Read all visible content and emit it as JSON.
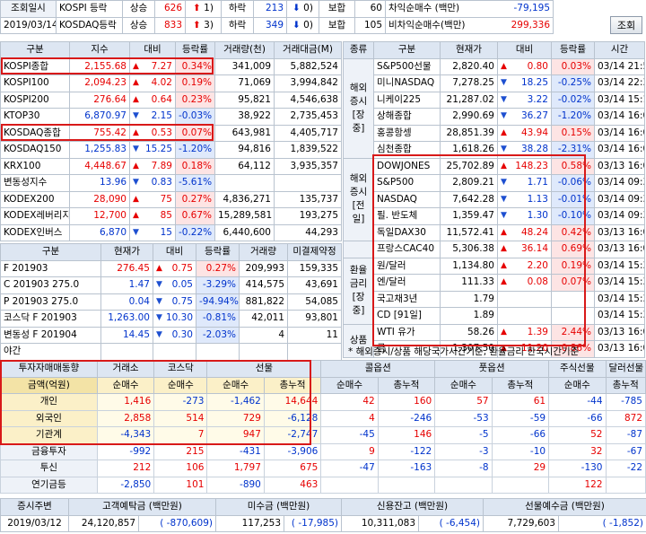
{
  "top": {
    "label1": "조회일시",
    "date": "2019/03/14",
    "rows": [
      {
        "market": "KOSPI 등락",
        "up_label": "상승",
        "up": "626",
        "limit_up": "1",
        "down_label": "하락",
        "down": "213",
        "limit_down": "0",
        "flat_label": "보합",
        "flat": "60"
      },
      {
        "market": "KOSDAQ등락",
        "up_label": "상승",
        "up": "833",
        "limit_up": "3",
        "down_label": "하락",
        "down": "349",
        "limit_down": "0",
        "flat_label": "보합",
        "flat": "105"
      }
    ],
    "arb": [
      {
        "label": "차익순매수 (백만)",
        "value": "-79,195"
      },
      {
        "label": "비차익순매수(백만)",
        "value": "299,336"
      }
    ],
    "query_button": "조회"
  },
  "index_table": {
    "headers": [
      "구분",
      "지수",
      "대비",
      "등락률",
      "거래량(천)",
      "거래대금(M)"
    ],
    "rows": [
      {
        "name": "KOSPI종합",
        "value": "2,155.68",
        "dir": "up",
        "change": "7.27",
        "rate": "0.34%",
        "vol": "341,009",
        "amt": "5,882,524"
      },
      {
        "name": "KOSPI100",
        "value": "2,094.23",
        "dir": "up",
        "change": "4.02",
        "rate": "0.19%",
        "vol": "71,069",
        "amt": "3,994,842"
      },
      {
        "name": "KOSPI200",
        "value": "276.64",
        "dir": "up",
        "change": "0.64",
        "rate": "0.23%",
        "vol": "95,821",
        "amt": "4,546,638"
      },
      {
        "name": "KTOP30",
        "value": "6,870.97",
        "dir": "dn",
        "change": "2.15",
        "rate": "-0.03%",
        "vol": "38,922",
        "amt": "2,735,453"
      },
      {
        "name": "KOSDAQ종합",
        "value": "755.42",
        "dir": "up",
        "change": "0.53",
        "rate": "0.07%",
        "vol": "643,981",
        "amt": "4,405,717"
      },
      {
        "name": "KOSDAQ150",
        "value": "1,255.83",
        "dir": "dn",
        "change": "15.25",
        "rate": "-1.20%",
        "vol": "94,816",
        "amt": "1,839,522"
      },
      {
        "name": "KRX100",
        "value": "4,448.67",
        "dir": "up",
        "change": "7.89",
        "rate": "0.18%",
        "vol": "64,112",
        "amt": "3,935,357"
      },
      {
        "name": "변동성지수",
        "value": "13.96",
        "dir": "dn",
        "change": "0.83",
        "rate": "-5.61%",
        "vol": "",
        "amt": ""
      },
      {
        "name": "KODEX200",
        "value": "28,090",
        "dir": "up",
        "change": "75",
        "rate": "0.27%",
        "vol": "4,836,271",
        "amt": "135,737"
      },
      {
        "name": "KODEX레버리지",
        "value": "12,700",
        "dir": "up",
        "change": "85",
        "rate": "0.67%",
        "vol": "15,289,581",
        "amt": "193,275"
      },
      {
        "name": "KODEX인버스",
        "value": "6,870",
        "dir": "dn",
        "change": "15",
        "rate": "-0.22%",
        "vol": "6,440,600",
        "amt": "44,293"
      }
    ]
  },
  "futures_table": {
    "headers": [
      "구분",
      "현재가",
      "대비",
      "등락률",
      "거래량",
      "미결제약정"
    ],
    "rows": [
      {
        "name": "F 201903",
        "price": "276.45",
        "dir": "up",
        "change": "0.75",
        "rate": "0.27%",
        "vol": "209,993",
        "oi": "159,335"
      },
      {
        "name": "C 201903 275.0",
        "price": "1.47",
        "dir": "dn",
        "change": "0.05",
        "rate": "-3.29%",
        "vol": "414,575",
        "oi": "43,691"
      },
      {
        "name": "P 201903 275.0",
        "price": "0.04",
        "dir": "dn",
        "change": "0.75",
        "rate": "-94.94%",
        "vol": "881,822",
        "oi": "54,085"
      },
      {
        "name": "코스닥 F 201903",
        "price": "1,263.00",
        "dir": "dn",
        "change": "10.30",
        "rate": "-0.81%",
        "vol": "42,011",
        "oi": "93,801"
      },
      {
        "name": "변동성 F 201904",
        "price": "14.45",
        "dir": "dn",
        "change": "0.30",
        "rate": "-2.03%",
        "vol": "4",
        "oi": "11"
      },
      {
        "name": "야간",
        "price": "",
        "dir": "",
        "change": "",
        "rate": "",
        "vol": "",
        "oi": ""
      }
    ]
  },
  "global_table": {
    "headers": [
      "종류",
      "구분",
      "현재가",
      "대비",
      "등락률",
      "시간"
    ],
    "groups": [
      {
        "label": "해외\n증시\n[장중]",
        "rows": [
          {
            "name": "S&P500선물",
            "price": "2,820.40",
            "dir": "up",
            "change": "0.80",
            "rate": "0.03%",
            "time": "03/14 21:56"
          },
          {
            "name": "미니NASDAQ",
            "price": "7,278.25",
            "dir": "dn",
            "change": "18.25",
            "rate": "-0.25%",
            "time": "03/14 22:39"
          },
          {
            "name": "니케이225",
            "price": "21,287.02",
            "dir": "dn",
            "change": "3.22",
            "rate": "-0.02%",
            "time": "03/14 15:15"
          },
          {
            "name": "상해종합",
            "price": "2,990.69",
            "dir": "dn",
            "change": "36.27",
            "rate": "-1.20%",
            "time": "03/14 16:00"
          },
          {
            "name": "홍콩항셍",
            "price": "28,851.39",
            "dir": "up",
            "change": "43.94",
            "rate": "0.15%",
            "time": "03/14 16:00"
          },
          {
            "name": "심천종합",
            "price": "1,618.26",
            "dir": "dn",
            "change": "38.28",
            "rate": "-2.31%",
            "time": "03/14 16:00"
          }
        ]
      },
      {
        "label": "해외\n증시\n[전일]",
        "rows": [
          {
            "name": "DOWJONES",
            "price": "25,702.89",
            "dir": "up",
            "change": "148.23",
            "rate": "0.58%",
            "time": "03/13 16:00"
          },
          {
            "name": "S&P500",
            "price": "2,809.21",
            "dir": "dn",
            "change": "1.71",
            "rate": "-0.06%",
            "time": "03/14 09:30"
          },
          {
            "name": "NASDAQ",
            "price": "7,642.28",
            "dir": "dn",
            "change": "1.13",
            "rate": "-0.01%",
            "time": "03/14 09:30"
          },
          {
            "name": "필. 반도체",
            "price": "1,359.47",
            "dir": "dn",
            "change": "1.30",
            "rate": "-0.10%",
            "time": "03/14 09:30"
          },
          {
            "name": "독일DAX30",
            "price": "11,572.41",
            "dir": "up",
            "change": "48.24",
            "rate": "0.42%",
            "time": "03/13 16:00"
          }
        ]
      },
      {
        "label": "",
        "rows": [
          {
            "name": "프랑스CAC40",
            "price": "5,306.38",
            "dir": "up",
            "change": "36.14",
            "rate": "0.69%",
            "time": "03/13 16:00"
          }
        ]
      },
      {
        "label": "환율\n금리\n[장중]",
        "rows": [
          {
            "name": "원/달러",
            "price": "1,134.80",
            "dir": "up",
            "change": "2.20",
            "rate": "0.19%",
            "time": "03/14 15:30"
          },
          {
            "name": "엔/달러",
            "price": "111.33",
            "dir": "up",
            "change": "0.08",
            "rate": "0.07%",
            "time": "03/14 15:30"
          },
          {
            "name": "국고채3년",
            "price": "1.79",
            "dir": "",
            "change": "",
            "rate": "",
            "time": "03/14 15:30"
          },
          {
            "name": "CD [91일]",
            "price": "1.89",
            "dir": "",
            "change": "",
            "rate": "",
            "time": "03/14 15:30"
          }
        ]
      },
      {
        "label": "상품",
        "rows": [
          {
            "name": "WTI 유가",
            "price": "58.26",
            "dir": "up",
            "change": "1.39",
            "rate": "2.44%",
            "time": "03/13 16:00"
          },
          {
            "name": "금",
            "price": "1,307.50",
            "dir": "up",
            "change": "11.20",
            "rate": "0.86%",
            "time": "03/13 16:00"
          }
        ]
      }
    ],
    "note": "* 해외증시/상품 해당국가시간기준, 환율금리 한국시간기준"
  },
  "investor_table": {
    "title": "투자자매매동향",
    "unit": "금액(억원)",
    "col_groups": [
      "거래소",
      "코스닥",
      "선물",
      "콜옵션",
      "풋옵션",
      "주식선물",
      "달러선물"
    ],
    "sub": [
      "순매수",
      "순매수",
      "순매수",
      "총누적",
      "순매수",
      "총누적",
      "순매수",
      "총누적",
      "순매수",
      "총누적"
    ],
    "rows": [
      {
        "name": "개인",
        "v": [
          "1,416",
          "-273",
          "-1,462",
          "14,644",
          "42",
          "160",
          "57",
          "61",
          "-44",
          "-785"
        ]
      },
      {
        "name": "외국인",
        "v": [
          "2,858",
          "514",
          "729",
          "-6,128",
          "4",
          "-246",
          "-53",
          "-59",
          "-66",
          "872"
        ]
      },
      {
        "name": "기관계",
        "v": [
          "-4,343",
          "7",
          "947",
          "-2,747",
          "-45",
          "146",
          "-5",
          "-66",
          "52",
          "-87"
        ]
      },
      {
        "name": "금융투자",
        "v": [
          "-992",
          "215",
          "-431",
          "-3,906",
          "9",
          "-122",
          "-3",
          "-10",
          "32",
          "-67"
        ]
      },
      {
        "name": "투신",
        "v": [
          "212",
          "106",
          "1,797",
          "675",
          "-47",
          "-163",
          "-8",
          "29",
          "-130",
          "-22"
        ]
      },
      {
        "name": "연기금등",
        "v": [
          "-2,850",
          "101",
          "-890",
          "463",
          "",
          "",
          "",
          "",
          "122",
          ""
        ]
      }
    ]
  },
  "bottom": {
    "headers": [
      "증시주변",
      "고객예탁금 (백만원)",
      "미수금 (백만원)",
      "신용잔고 (백만원)",
      "선물예수금 (백만원)"
    ],
    "date": "2019/03/12",
    "values": [
      {
        "v": "24,120,857",
        "d": "-870,609"
      },
      {
        "v": "117,253",
        "d": "-17,985"
      },
      {
        "v": "10,311,083",
        "d": "-6,454"
      },
      {
        "v": "7,729,603",
        "d": "-1,852"
      }
    ]
  }
}
